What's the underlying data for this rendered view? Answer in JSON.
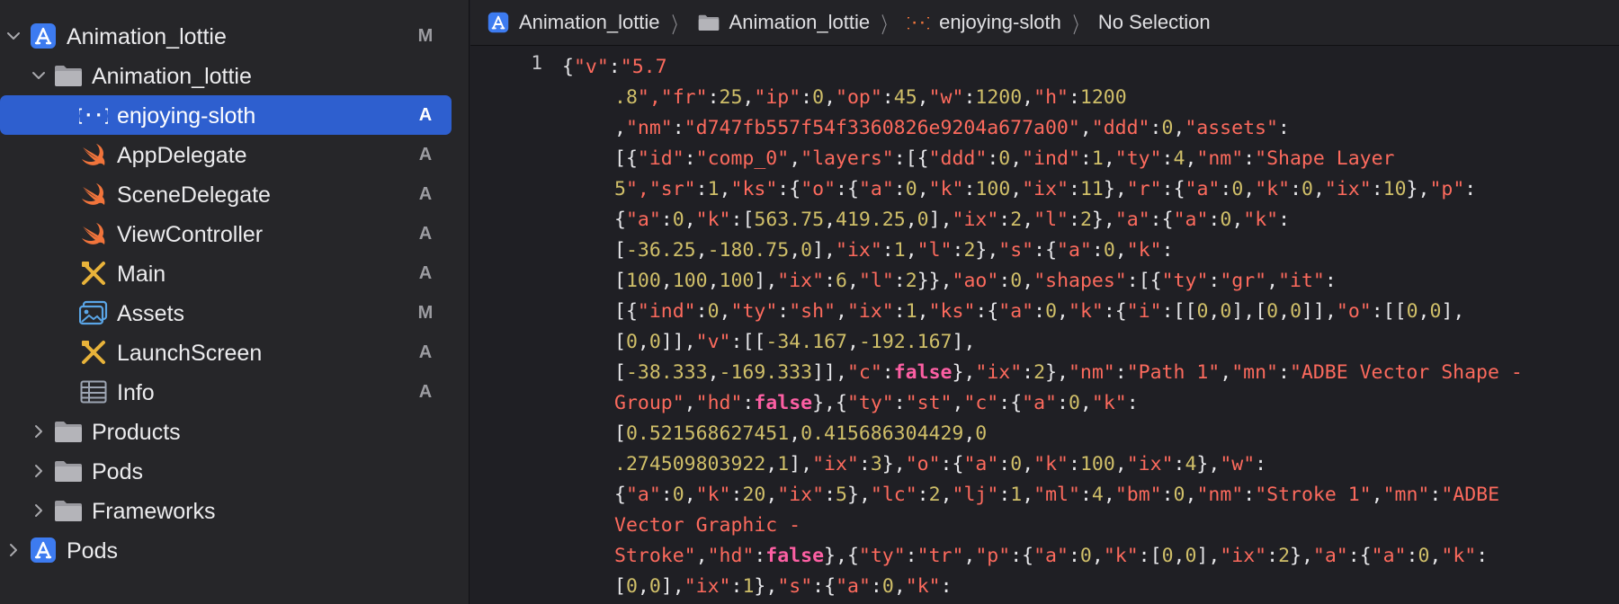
{
  "navigator": {
    "rows": [
      {
        "label": "Animation_lottie",
        "badge": "M",
        "icon": "xcode-project-icon",
        "chevron": "down"
      },
      {
        "label": "Animation_lottie",
        "badge": "",
        "icon": "folder-icon",
        "chevron": "down"
      },
      {
        "label": "enjoying-sloth",
        "badge": "A",
        "icon": "json-file-icon",
        "chevron": ""
      },
      {
        "label": "AppDelegate",
        "badge": "A",
        "icon": "swift-file-icon",
        "chevron": ""
      },
      {
        "label": "SceneDelegate",
        "badge": "A",
        "icon": "swift-file-icon",
        "chevron": ""
      },
      {
        "label": "ViewController",
        "badge": "A",
        "icon": "swift-file-icon",
        "chevron": ""
      },
      {
        "label": "Main",
        "badge": "A",
        "icon": "storyboard-icon",
        "chevron": ""
      },
      {
        "label": "Assets",
        "badge": "M",
        "icon": "asset-catalog-icon",
        "chevron": ""
      },
      {
        "label": "LaunchScreen",
        "badge": "A",
        "icon": "storyboard-icon",
        "chevron": ""
      },
      {
        "label": "Info",
        "badge": "A",
        "icon": "plist-table-icon",
        "chevron": ""
      },
      {
        "label": "Products",
        "badge": "",
        "icon": "folder-icon",
        "chevron": "right"
      },
      {
        "label": "Pods",
        "badge": "",
        "icon": "folder-icon",
        "chevron": "right"
      },
      {
        "label": "Frameworks",
        "badge": "",
        "icon": "folder-icon",
        "chevron": "right"
      },
      {
        "label": "Pods",
        "badge": "",
        "icon": "xcode-project-icon",
        "chevron": "right"
      }
    ],
    "selected_index": 2
  },
  "jumpbar": {
    "items": [
      {
        "label": "Animation_lottie",
        "icon": "xcode-project-icon"
      },
      {
        "label": "Animation_lottie",
        "icon": "folder-icon"
      },
      {
        "label": "enjoying-sloth",
        "icon": "json-file-icon"
      },
      {
        "label": "No Selection",
        "icon": ""
      }
    ]
  },
  "editor": {
    "line_number": "1",
    "lines": [
      "{\"v\":\"5.7",
      ".8\",\"fr\":25,\"ip\":0,\"op\":45,\"w\":1200,\"h\":1200",
      ",\"nm\":\"d747fb557f54f3360826e9204a677a00\",\"ddd\":0,\"assets\":",
      "[{\"id\":\"comp_0\",\"layers\":[{\"ddd\":0,\"ind\":1,\"ty\":4,\"nm\":\"Shape Layer",
      "5\",\"sr\":1,\"ks\":{\"o\":{\"a\":0,\"k\":100,\"ix\":11},\"r\":{\"a\":0,\"k\":0,\"ix\":10},\"p\":",
      "{\"a\":0,\"k\":[563.75,419.25,0],\"ix\":2,\"l\":2},\"a\":{\"a\":0,\"k\":",
      "[-36.25,-180.75,0],\"ix\":1,\"l\":2},\"s\":{\"a\":0,\"k\":",
      "[100,100,100],\"ix\":6,\"l\":2}},\"ao\":0,\"shapes\":[{\"ty\":\"gr\",\"it\":",
      "[{\"ind\":0,\"ty\":\"sh\",\"ix\":1,\"ks\":{\"a\":0,\"k\":{\"i\":[[0,0],[0,0]],\"o\":[[0,0],",
      "[0,0]],\"v\":[[-34.167,-192.167],",
      "[-38.333,-169.333]],\"c\":false},\"ix\":2},\"nm\":\"Path 1\",\"mn\":\"ADBE Vector Shape -",
      "Group\",\"hd\":false},{\"ty\":\"st\",\"c\":{\"a\":0,\"k\":",
      "[0.521568627451,0.415686304429,0",
      ".274509803922,1],\"ix\":3},\"o\":{\"a\":0,\"k\":100,\"ix\":4},\"w\":",
      "{\"a\":0,\"k\":20,\"ix\":5},\"lc\":2,\"lj\":1,\"ml\":4,\"bm\":0,\"nm\":\"Stroke 1\",\"mn\":\"ADBE",
      "Vector Graphic -",
      "Stroke\",\"hd\":false},{\"ty\":\"tr\",\"p\":{\"a\":0,\"k\":[0,0],\"ix\":2},\"a\":{\"a\":0,\"k\":",
      "[0,0],\"ix\":1},\"s\":{\"a\":0,\"k\":"
    ]
  },
  "colors": {
    "string": "#fc6a5d",
    "number": "#d0bf69",
    "keyword": "#fc5fa3",
    "selection": "#2e5fcf"
  }
}
